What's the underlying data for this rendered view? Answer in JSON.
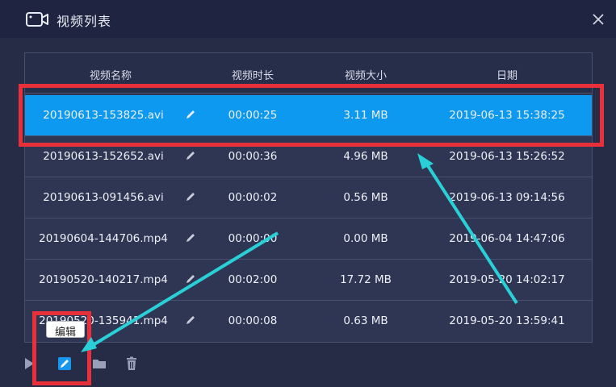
{
  "window": {
    "title": "视频列表",
    "icon": "video-camera-icon",
    "close_icon": "close-icon"
  },
  "table": {
    "headers": [
      "视频名称",
      "视频时长",
      "视频大小",
      "日期"
    ],
    "rows": [
      {
        "name": "20190613-153825.avi",
        "duration": "00:00:25",
        "size": "3.11 MB",
        "date": "2019-06-13 15:38:25",
        "selected": true
      },
      {
        "name": "20190613-152652.avi",
        "duration": "00:00:36",
        "size": "4.96 MB",
        "date": "2019-06-13 15:26:52",
        "selected": false
      },
      {
        "name": "20190613-091456.avi",
        "duration": "00:00:02",
        "size": "0.56 MB",
        "date": "2019-06-13 09:14:56",
        "selected": false
      },
      {
        "name": "20190604-144706.mp4",
        "duration": "00:00:00",
        "size": "0.00 MB",
        "date": "2019-06-04 14:47:06",
        "selected": false
      },
      {
        "name": "20190520-140217.mp4",
        "duration": "00:02:00",
        "size": "17.72 MB",
        "date": "2019-05-20 14:02:17",
        "selected": false
      },
      {
        "name": "20190520-135941.mp4",
        "duration": "00:00:08",
        "size": "0.63 MB",
        "date": "2019-05-20 13:59:41",
        "selected": false
      }
    ],
    "edit_icon": "pencil-icon"
  },
  "toolbar": {
    "tooltip": "编辑",
    "buttons": [
      "play-icon",
      "edit-icon",
      "folder-icon",
      "trash-icon"
    ]
  },
  "colors": {
    "selected_row": "#0d99f0",
    "annotation_red": "#e8303a",
    "annotation_arrow": "#2ad0d8"
  }
}
